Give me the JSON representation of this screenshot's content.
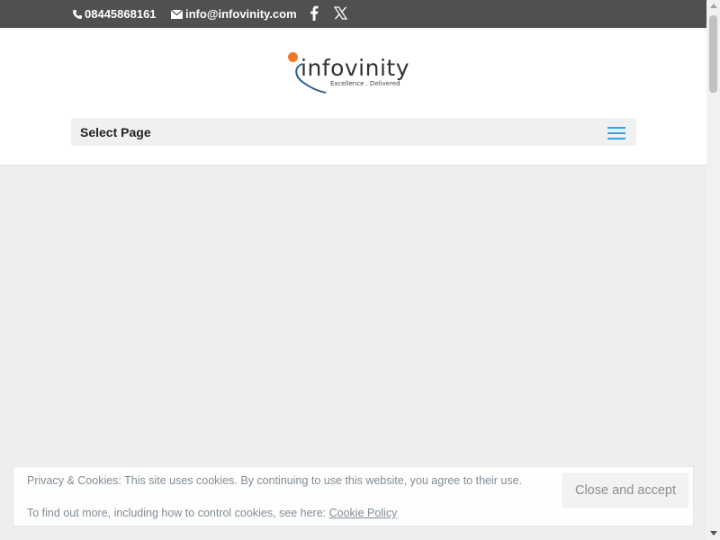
{
  "topbar": {
    "phone": "08445868161",
    "email": "info@infovinity.com",
    "social": [
      "facebook-icon",
      "x-icon"
    ],
    "background": "#505050"
  },
  "header": {
    "logo_text": "infovinity",
    "logo_tagline": "Excellence . Delivered",
    "menu_label": "Select Page",
    "accent": "#2ea3f2",
    "logo_accent": "#f07a2a"
  },
  "cookie": {
    "line1": "Privacy & Cookies: This site uses cookies. By continuing to use this website, you agree to their use.",
    "line2": "To find out more, including how to control cookies, see here: ",
    "link": "Cookie Policy",
    "button": "Close and accept"
  }
}
